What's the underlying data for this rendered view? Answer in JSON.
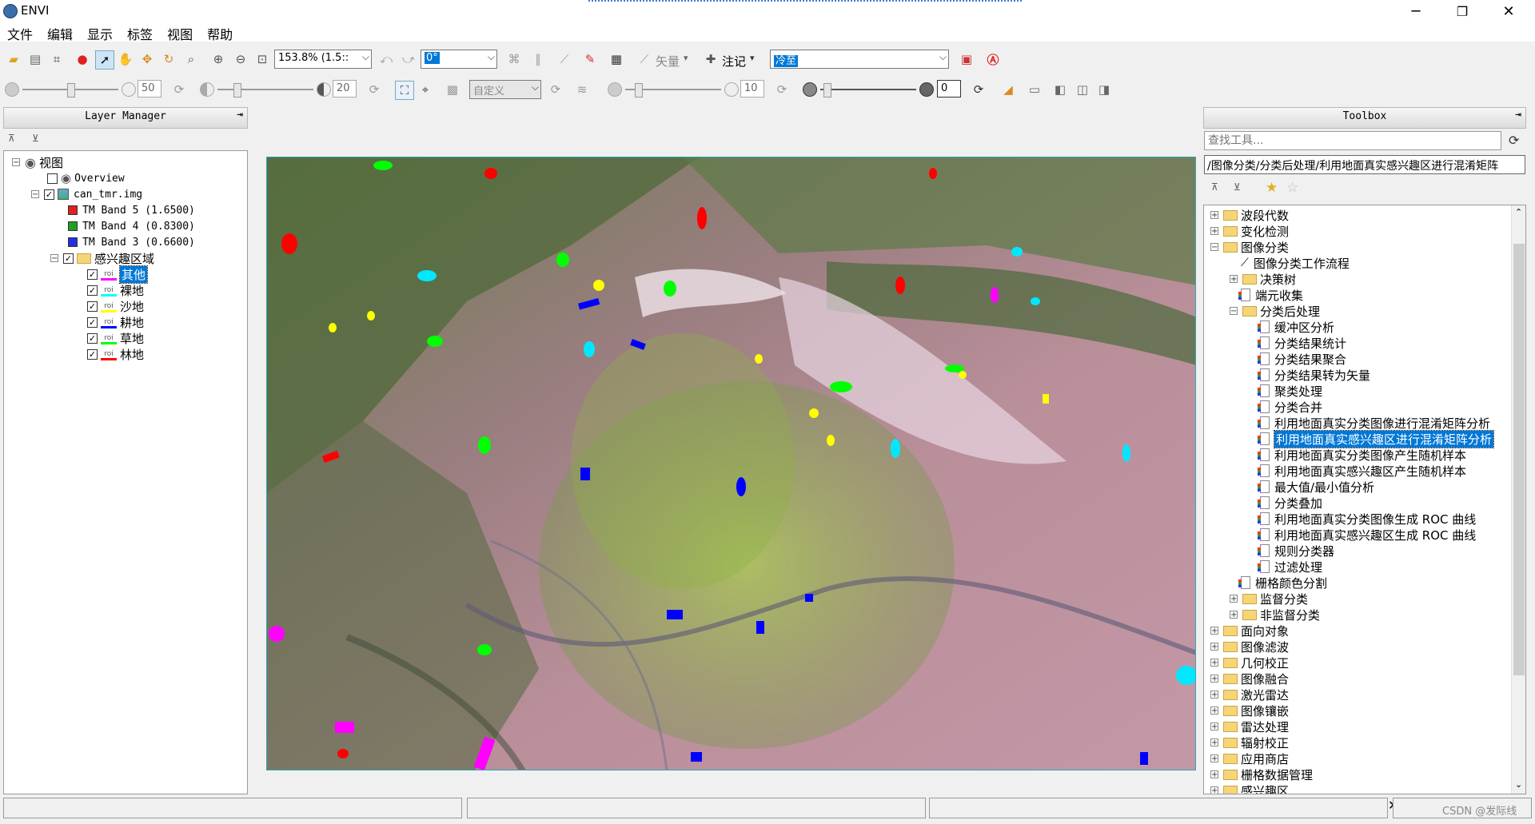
{
  "window": {
    "title": "ENVI",
    "minimize": "─",
    "maximize": "❐",
    "close": "✕"
  },
  "menu": [
    "文件",
    "编辑",
    "显示",
    "标签",
    "视图",
    "帮助"
  ],
  "toolbar1": {
    "zoom_value": "153.8% (1.5::",
    "rotation_value": "0°",
    "vector_label": "矢量",
    "annotation_label": "注记",
    "stretch_value": "冷至"
  },
  "toolbar2": {
    "brightness_value": "50",
    "contrast_value": "20",
    "stretch_type": "自定义",
    "sharpen_value": "10",
    "transparency_value": "0"
  },
  "layer_manager": {
    "title": "Layer Manager",
    "root": "视图",
    "overview": "Overview",
    "file": "can_tmr.img",
    "bands": [
      {
        "label": "TM Band 5 (1.6500)",
        "color": "#e02020"
      },
      {
        "label": "TM Band 4 (0.8300)",
        "color": "#20a020"
      },
      {
        "label": "TM Band 3 (0.6600)",
        "color": "#2030e0"
      }
    ],
    "roi_group": "感兴趣区域",
    "rois": [
      {
        "label": "其他",
        "color": "#ff00ff",
        "selected": true
      },
      {
        "label": "裸地",
        "color": "#00ffff",
        "selected": false
      },
      {
        "label": "沙地",
        "color": "#ffff00",
        "selected": false
      },
      {
        "label": "耕地",
        "color": "#0000ff",
        "selected": false
      },
      {
        "label": "草地",
        "color": "#00ff00",
        "selected": false
      },
      {
        "label": "林地",
        "color": "#ff0000",
        "selected": false
      }
    ]
  },
  "toolbox": {
    "title": "Toolbox",
    "search_placeholder": "查找工具...",
    "path": "/图像分类/分类后处理/利用地面真实感兴趣区进行混淆矩阵",
    "categories_top": [
      "波段代数",
      "变化检测",
      "图像分类"
    ],
    "classification_children": [
      "图像分类工作流程",
      "决策树",
      "端元收集",
      "分类后处理"
    ],
    "post_classification": [
      "缓冲区分析",
      "分类结果统计",
      "分类结果聚合",
      "分类结果转为矢量",
      "聚类处理",
      "分类合并",
      "利用地面真实分类图像进行混淆矩阵分析",
      "利用地面真实感兴趣区进行混淆矩阵分析",
      "利用地面真实分类图像产生随机样本",
      "利用地面真实感兴趣区产生随机样本",
      "最大值/最小值分析",
      "分类叠加",
      "利用地面真实分类图像生成 ROC 曲线",
      "利用地面真实感兴趣区生成 ROC 曲线",
      "规则分类器",
      "过滤处理"
    ],
    "selected_tool": "利用地面真实感兴趣区进行混淆矩阵分析",
    "classification_tail": [
      "栅格颜色分割",
      "监督分类",
      "非监督分类"
    ],
    "categories_bottom": [
      "面向对象",
      "图像滤波",
      "几何校正",
      "图像融合",
      "激光雷达",
      "图像镶嵌",
      "雷达处理",
      "辐射校正",
      "应用商店",
      "栅格数据管理",
      "感兴趣区"
    ]
  },
  "watermark": "CSDN @发际线"
}
